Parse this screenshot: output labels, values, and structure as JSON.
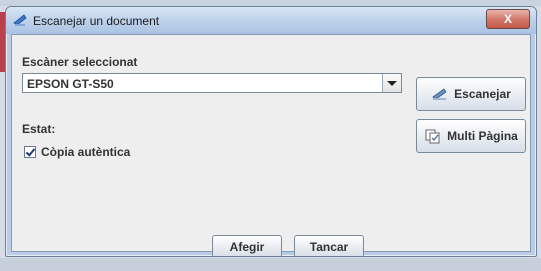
{
  "window": {
    "title": "Escanejar un document",
    "close_label": "X"
  },
  "scanner": {
    "label": "Escàner seleccionat",
    "selected": "EPSON GT-S50"
  },
  "status": {
    "label": "Estat:"
  },
  "option": {
    "label": "Còpia autèntica",
    "checked": true
  },
  "buttons": {
    "scan": "Escanejar",
    "multi_page": "Multi Pàgina",
    "add": "Afegir",
    "close": "Tancar"
  }
}
